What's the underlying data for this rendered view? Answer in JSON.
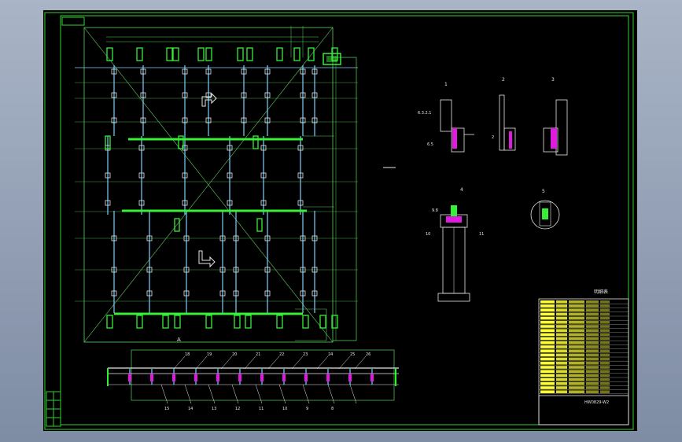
{
  "viewport": {
    "background": "#000000",
    "frame_color": "#2fd42f"
  },
  "colors": {
    "frame": "#2fd42f",
    "grid": "#5ed15e",
    "column": "#7fd0ff",
    "beam": "#35f035",
    "node": "#e8e8e8",
    "highlight": "#e01be0",
    "table_fill": "#ffff33"
  },
  "drawing": {
    "number": "HW0829-W2",
    "title_suffix": "HW0829-W2"
  },
  "views": {
    "section_a": "A",
    "detail_1": "1",
    "detail_2": "2",
    "detail_3": "3",
    "detail_4": "4",
    "detail_5": "5"
  },
  "callouts": [
    "18",
    "19",
    "20",
    "21",
    "22",
    "23",
    "24",
    "25",
    "26",
    "15",
    "14",
    "13",
    "12",
    "11",
    "10",
    "9",
    "8"
  ],
  "detail_labels": {
    "left": "6.3.2.1",
    "left2": "6.5",
    "mid": "2",
    "bottom_left": "10",
    "bottom_right": "11",
    "bottom_top": "9.8",
    "circle": "3"
  },
  "table": {
    "title": "明细表",
    "rows": 23
  }
}
